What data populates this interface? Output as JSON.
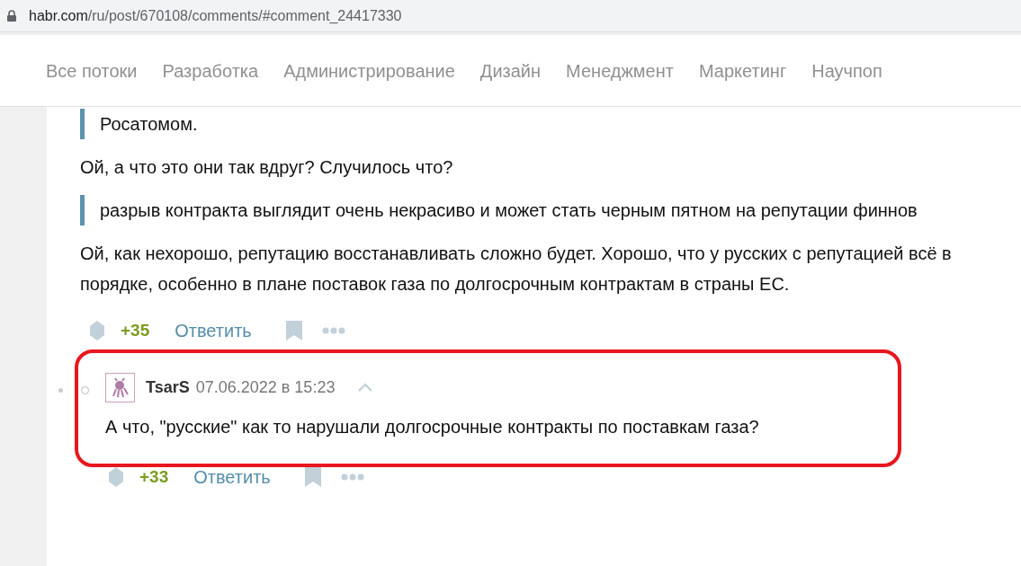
{
  "address_bar": {
    "url_host": "habr.com",
    "url_path": "/ru/post/670108/comments/#comment_24417330"
  },
  "nav": {
    "items": [
      {
        "label": "Все потоки",
        "selected": false
      },
      {
        "label": "Разработка",
        "selected": false
      },
      {
        "label": "Администрирование",
        "selected": false
      },
      {
        "label": "Дизайн",
        "selected": false
      },
      {
        "label": "Менеджмент",
        "selected": false
      },
      {
        "label": "Маркетинг",
        "selected": false
      },
      {
        "label": "Научпоп",
        "selected": false
      }
    ]
  },
  "comment": {
    "blocks": [
      {
        "kind": "quote",
        "text": "Росатомом."
      },
      {
        "kind": "paragraph",
        "text": "Ой, а что это они так вдруг? Случилось что?"
      },
      {
        "kind": "quote",
        "text": "разрыв контракта выглядит очень некрасиво и может стать черным пятном на репутации финнов"
      },
      {
        "kind": "paragraph",
        "text": "Ой, как нехорошо, репутацию восстанавливать сложно будет. Хорошо, что у русских с репутацией всё в порядке, особенно в плане поставок газа по долгосрочным контрактам в страны ЕС."
      }
    ],
    "score": "+35",
    "reply_label": "Ответить"
  },
  "reply": {
    "highlighted": true,
    "author": "TsarS",
    "date": "07.06.2022 в 15:23",
    "text": "А что, \"русские\" как то нарушали долгосрочные контракты по поставкам газа?",
    "score": "+33",
    "reply_label": "Ответить"
  }
}
